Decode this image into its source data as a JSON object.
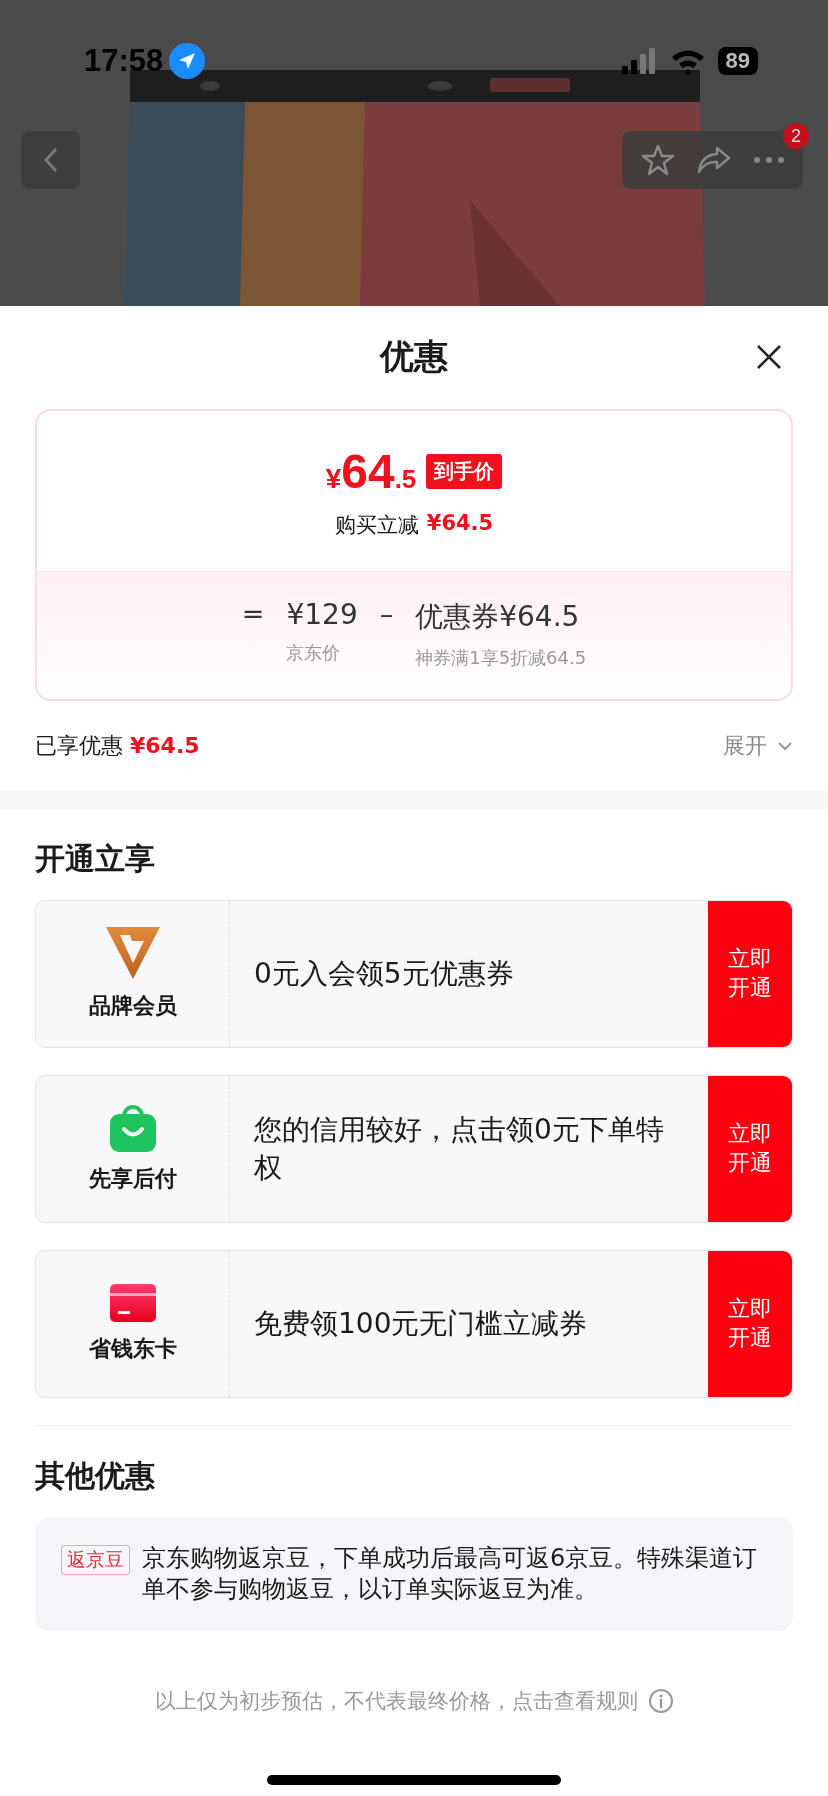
{
  "status_bar": {
    "time": "17:58",
    "battery": "89"
  },
  "top_bar": {
    "badge": "2"
  },
  "sheet": {
    "title": "优惠"
  },
  "price_card": {
    "price_symbol": "¥",
    "price_main": "64",
    "price_decimal": ".5",
    "price_tag": "到手价",
    "reduction_label": "购买立减",
    "reduction_value": "¥64.5",
    "formula": [
      {
        "kind": "operator",
        "text": "="
      },
      {
        "kind": "term",
        "text": "¥129",
        "caption": "京东价"
      },
      {
        "kind": "operator",
        "text": "–"
      },
      {
        "kind": "term",
        "text": "优惠券¥64.5",
        "caption": "神券满1享5折减64.5"
      }
    ]
  },
  "enjoyed": {
    "label": "已享优惠",
    "value": "¥64.5",
    "toggle": "展开"
  },
  "open_section": {
    "title": "开通立享",
    "items": [
      {
        "kind": "member",
        "name": "品牌会员",
        "text": "0元入会领5元优惠券",
        "button": "立即开通"
      },
      {
        "kind": "paylater",
        "name": "先享后付",
        "text": "您的信用较好，点击领0元下单特权",
        "button": "立即开通"
      },
      {
        "kind": "card",
        "name": "省钱东卡",
        "text": "免费领100元无门槛立减券",
        "button": "立即开通"
      }
    ]
  },
  "other_section": {
    "title": "其他优惠",
    "items": [
      {
        "tag": "返京豆",
        "text": "京东购物返京豆，下单成功后最高可返6京豆。特殊渠道订单不参与购物返豆，以订单实际返豆为准。"
      }
    ]
  },
  "footer": "以上仅为初步预估，不代表最终价格，点击查看规则"
}
